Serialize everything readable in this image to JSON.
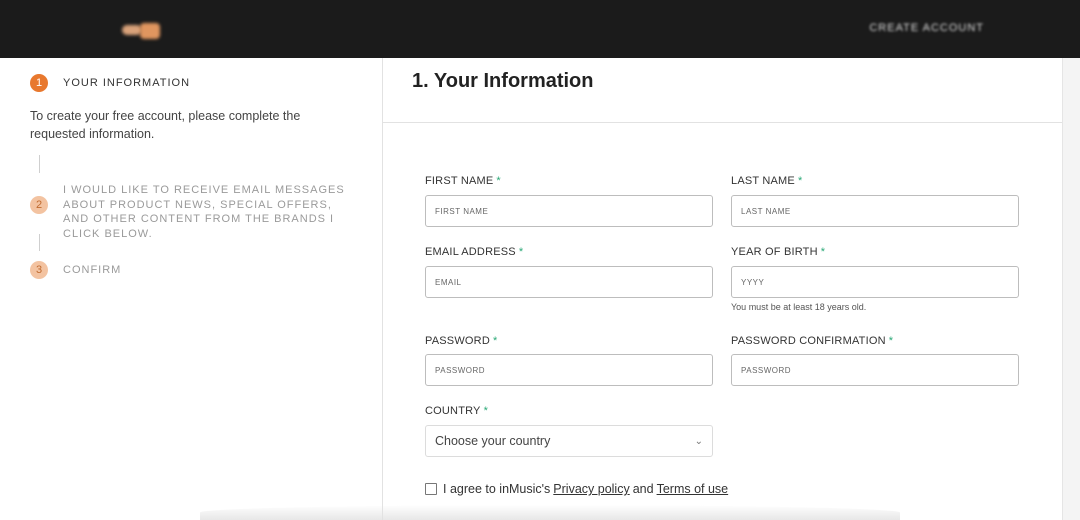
{
  "header": {
    "logo_icon": "brand-logo-icon",
    "account_link": "CREATE ACCOUNT"
  },
  "sidebar": {
    "steps": [
      {
        "number": "1",
        "label": "YOUR INFORMATION",
        "status": "active"
      },
      {
        "number": "2",
        "label": "I WOULD LIKE TO RECEIVE EMAIL MESSAGES ABOUT PRODUCT NEWS, SPECIAL OFFERS, AND OTHER CONTENT FROM THE BRANDS I CLICK BELOW.",
        "status": "pending"
      },
      {
        "number": "3",
        "label": "CONFIRM",
        "status": "pending"
      }
    ],
    "intro": "To create your free account, please complete the requested information."
  },
  "form": {
    "heading": "1. Your Information",
    "required_marker": "*",
    "first_name": {
      "label": "FIRST NAME",
      "placeholder": "FIRST NAME",
      "value": ""
    },
    "last_name": {
      "label": "LAST NAME",
      "placeholder": "LAST NAME",
      "value": ""
    },
    "email": {
      "label": "EMAIL ADDRESS",
      "placeholder": "EMAIL",
      "value": ""
    },
    "year_of_birth": {
      "label": "YEAR OF BIRTH",
      "placeholder": "YYYY",
      "value": "",
      "hint": "You must be at least 18 years old."
    },
    "password": {
      "label": "PASSWORD",
      "placeholder": "PASSWORD",
      "value": ""
    },
    "password_confirmation": {
      "label": "PASSWORD CONFIRMATION",
      "placeholder": "PASSWORD",
      "value": ""
    },
    "country": {
      "label": "COUNTRY",
      "selected": "Choose your country"
    },
    "agree": {
      "prefix": "I agree to inMusic's",
      "privacy_link": "Privacy policy",
      "and": "and",
      "terms_link": "Terms of use",
      "checked": false
    }
  },
  "colors": {
    "accent": "#e8782e",
    "accent_light": "#f3c3a1",
    "required": "#2aa876",
    "header_bg": "#1b1b1b"
  }
}
